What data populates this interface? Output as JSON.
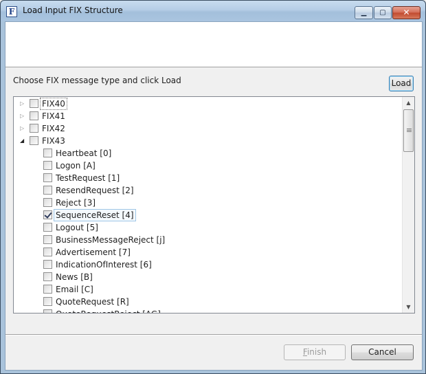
{
  "window": {
    "title": "Load Input FIX Structure",
    "icon_letter": "F",
    "controls": {
      "minimize": "▁",
      "maximize": "▢",
      "close": "✕"
    }
  },
  "instruction": "Choose FIX message type and click Load",
  "buttons": {
    "load": "Load",
    "finish_mnemonic": "F",
    "finish_rest": "inish",
    "cancel": "Cancel"
  },
  "tree": {
    "nodes": [
      {
        "label": "FIX40",
        "level": 0,
        "expander": "collapsed",
        "checked": false
      },
      {
        "label": "FIX41",
        "level": 0,
        "expander": "collapsed",
        "checked": false
      },
      {
        "label": "FIX42",
        "level": 0,
        "expander": "collapsed",
        "checked": false
      },
      {
        "label": "FIX43",
        "level": 0,
        "expander": "expanded",
        "checked": false
      },
      {
        "label": "Heartbeat [0]",
        "level": 1,
        "checked": false
      },
      {
        "label": "Logon [A]",
        "level": 1,
        "checked": false
      },
      {
        "label": "TestRequest [1]",
        "level": 1,
        "checked": false
      },
      {
        "label": "ResendRequest [2]",
        "level": 1,
        "checked": false
      },
      {
        "label": "Reject [3]",
        "level": 1,
        "checked": false
      },
      {
        "label": "SequenceReset [4]",
        "level": 1,
        "checked": true
      },
      {
        "label": "Logout [5]",
        "level": 1,
        "checked": false
      },
      {
        "label": "BusinessMessageReject [j]",
        "level": 1,
        "checked": false
      },
      {
        "label": "Advertisement [7]",
        "level": 1,
        "checked": false
      },
      {
        "label": "IndicationOfInterest [6]",
        "level": 1,
        "checked": false
      },
      {
        "label": "News [B]",
        "level": 1,
        "checked": false
      },
      {
        "label": "Email [C]",
        "level": 1,
        "checked": false
      },
      {
        "label": "QuoteRequest [R]",
        "level": 1,
        "checked": false
      },
      {
        "label": "QuoteRequestReject [AG]",
        "level": 1,
        "checked": false
      }
    ],
    "focused_index": 0,
    "selected_index": 9
  },
  "scrollbar": {
    "up_arrow": "▲",
    "down_arrow": "▼"
  },
  "icons": {
    "expander_collapsed": "▷",
    "expander_expanded": "◢"
  }
}
